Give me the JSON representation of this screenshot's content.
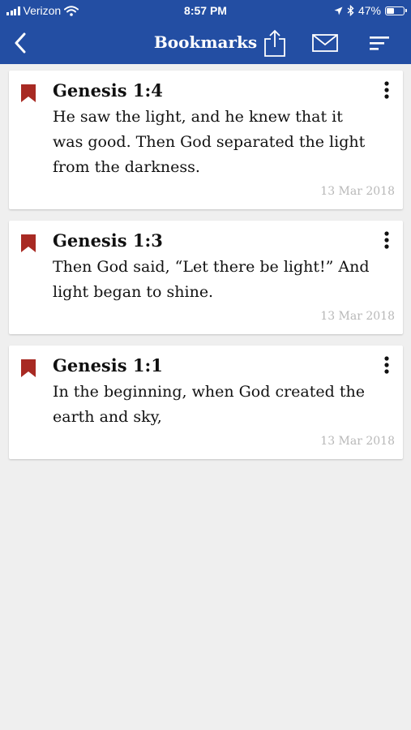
{
  "status_bar": {
    "carrier": "Verizon",
    "time": "8:57 PM",
    "battery": "47%"
  },
  "nav": {
    "title": "Bookmarks",
    "icons": [
      "back-chevron-icon",
      "share-icon",
      "mail-icon",
      "sort-icon"
    ]
  },
  "colors": {
    "header_bg": "#234ea3",
    "bookmark_flag": "#a82a23",
    "background": "#efefef",
    "date_text": "#b8b8b8"
  },
  "bookmarks": [
    {
      "reference": "Genesis 1:4",
      "text": "He saw the light, and he knew that it was good. Then God separated the light from the darkness.",
      "date": "13 Mar 2018"
    },
    {
      "reference": "Genesis 1:3",
      "text": "Then God said, “Let there be light!” And light began to shine.",
      "date": "13 Mar 2018"
    },
    {
      "reference": "Genesis 1:1",
      "text": "In the beginning, when God created the earth and sky,",
      "date": "13 Mar 2018"
    }
  ]
}
